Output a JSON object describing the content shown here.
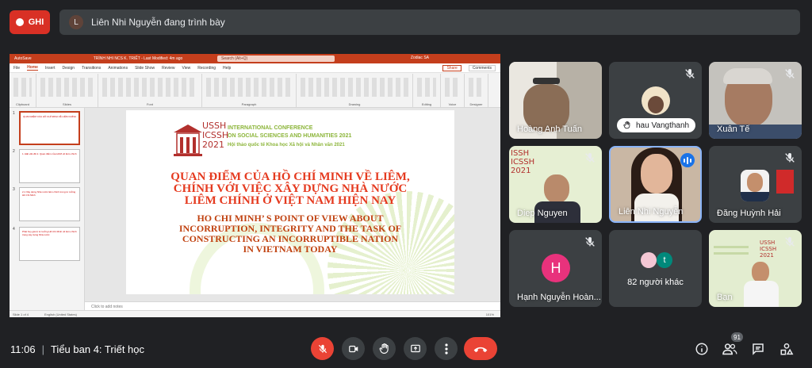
{
  "top": {
    "record_label": "GHI",
    "presenter_initial": "L",
    "presenting_text": "Liên Nhi Nguyễn đang trình bày"
  },
  "ppt": {
    "autosave": "AutoSave",
    "filename": "TRÌNH NHI NCS K. TRIẾT - Last Modified: 4m ago",
    "search": "Search (Alt+Q)",
    "user": "Zodiac SA",
    "menu": [
      "File",
      "Home",
      "Insert",
      "Design",
      "Transitions",
      "Animations",
      "Slide Show",
      "Review",
      "View",
      "Recording",
      "Help"
    ],
    "share": "Share",
    "comments": "Comments",
    "groups": [
      "Clipboard",
      "Slides",
      "Font",
      "Paragraph",
      "Drawing",
      "Editing",
      "Voice",
      "Designer"
    ],
    "thumb_texts": [
      "QUAN ĐIỂM CỦA HỒ CHÍ MINH VỀ LIÊM CHÍNH",
      "1. Đặt vấn đề  2. Quan điểm của HCM về liêm chính",
      "2.1 Xây dựng Nhà nước liêm chính trong tư tưởng Hồ Chí Minh",
      "Phát huy giá trị tư tưởng Hồ Chí Minh về liêm chính trong xây dựng Nhà nước"
    ],
    "notes": "Click to add notes",
    "status_slide": "Slide 1 of 4",
    "status_lang": "English (United States)",
    "status_zoom": "101%"
  },
  "slide": {
    "logo_words": [
      "USSH",
      "ICSSH",
      "2021"
    ],
    "conf_line1": "INTERNATIONAL CONFERENCE",
    "conf_line2": "ON SOCIAL SCIENCES AND HUMANITIES 2021",
    "conf_sub": "Hội thảo quốc tế Khoa học Xã hội và Nhân văn 2021",
    "vn_title": [
      "QUAN ĐIỂM CỦA HỒ CHÍ MINH VỀ LIÊM,",
      "CHÍNH VỚI VIỆC XÂY DỰNG NHÀ NƯỚC",
      "LIÊM CHÍNH Ở VIỆT NAM HIỆN NAY"
    ],
    "en_title": [
      "HO CHI MINH’ S POINT OF VIEW ABOUT",
      "INCORRUPTION, INTEGRITY AND THE TASK OF",
      "CONSTRUCTING AN INCORRUPTIBLE NATION",
      "IN VIETNAM TODAY"
    ]
  },
  "participants": [
    {
      "name": "Hoàng Anh Tuấn"
    },
    {
      "name": "hau Vangthanh"
    },
    {
      "name": "Xuân Tế"
    },
    {
      "name": "Diep Nguyen"
    },
    {
      "name": "Liên Nhi Nguyễn"
    },
    {
      "name": "Đăng Huỳnh Hải"
    },
    {
      "name": "Hạnh Nguyễn Hoàn...",
      "initial": "H"
    },
    {
      "name": "82 người khác",
      "initial": "t"
    },
    {
      "name": "Bạn"
    }
  ],
  "bottom": {
    "time": "11:06",
    "meeting": "Tiểu ban 4: Triết học",
    "people_count": "91"
  },
  "colors": {
    "record": "#d93025",
    "end_call": "#ea4335",
    "speaking": "#1a73e8",
    "avatar_h": "#e8327c",
    "avatar_t": "#00897b"
  }
}
